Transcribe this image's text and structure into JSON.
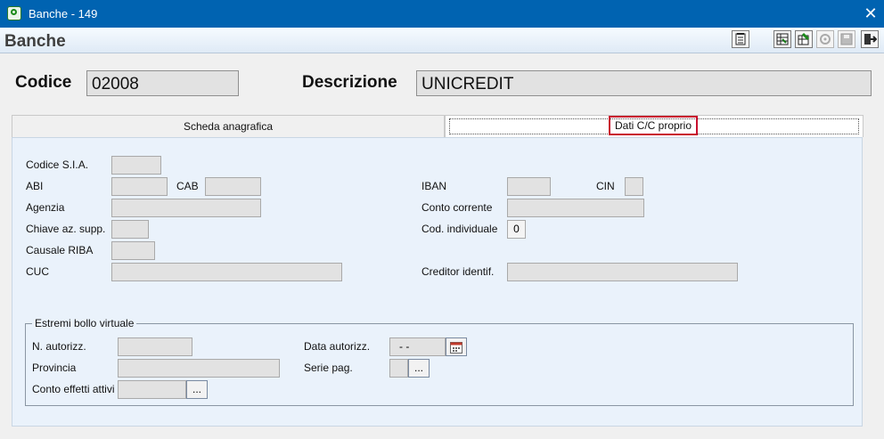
{
  "window": {
    "title": "Banche - 149",
    "close_symbol": "✕"
  },
  "header": {
    "title": "Banche"
  },
  "toolbar": {
    "buttons": [
      "report-button",
      "spreadsheet-button",
      "spreadsheet-edit-button",
      "settings-button",
      "save-button",
      "exit-button"
    ]
  },
  "record": {
    "code_label": "Codice",
    "code_value": "02008",
    "description_label": "Descrizione",
    "description_value": "UNICREDIT"
  },
  "tabs": [
    {
      "label": "Scheda anagrafica",
      "active": false
    },
    {
      "label": "Dati C/C proprio",
      "active": true
    }
  ],
  "form": {
    "codice_sia": {
      "label": "Codice S.I.A.",
      "value": ""
    },
    "abi": {
      "label": "ABI",
      "value": ""
    },
    "cab": {
      "label": "CAB",
      "value": ""
    },
    "agenzia": {
      "label": "Agenzia",
      "value": ""
    },
    "chiave": {
      "label": "Chiave az. supp.",
      "value": ""
    },
    "causale": {
      "label": "Causale RIBA",
      "value": ""
    },
    "cuc": {
      "label": "CUC",
      "value": ""
    },
    "iban": {
      "label": "IBAN",
      "value": ""
    },
    "cin": {
      "label": "CIN",
      "value": ""
    },
    "conto": {
      "label": "Conto corrente",
      "value": ""
    },
    "cod_individuale": {
      "label": "Cod. individuale",
      "value": "0"
    },
    "creditor": {
      "label": "Creditor identif.",
      "value": ""
    }
  },
  "bollo": {
    "title": "Estremi bollo virtuale",
    "n_autorizz": {
      "label": "N. autorizz.",
      "value": ""
    },
    "provincia": {
      "label": "Provincia",
      "value": ""
    },
    "conto_effetti": {
      "label": "Conto effetti attivi",
      "value": ""
    },
    "data_autorizz": {
      "label": "Data autorizz.",
      "value": "- -"
    },
    "serie_pag": {
      "label": "Serie pag.",
      "value": ""
    },
    "lookup_label": "..."
  }
}
